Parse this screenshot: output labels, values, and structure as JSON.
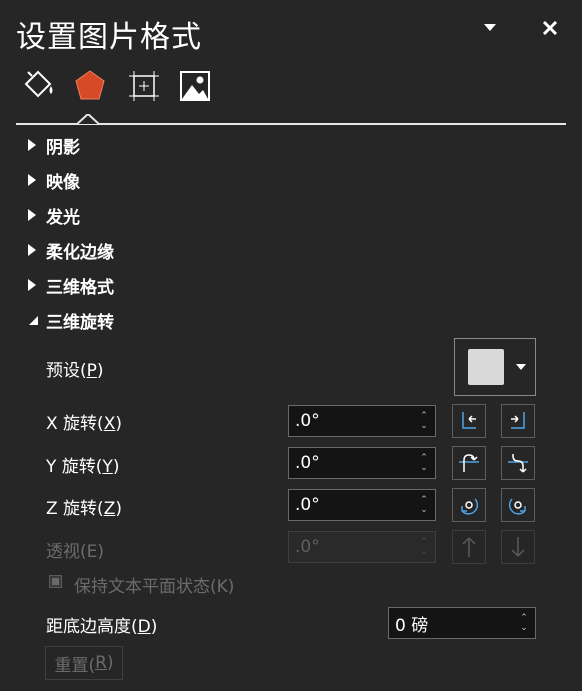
{
  "panel": {
    "title": "设置图片格式"
  },
  "tabs": [
    {
      "icon": "fill-line-icon"
    },
    {
      "icon": "effects-pentagon-icon"
    },
    {
      "icon": "size-properties-icon"
    },
    {
      "icon": "picture-icon"
    }
  ],
  "sections": [
    {
      "label": "阴影",
      "expanded": false
    },
    {
      "label": "映像",
      "expanded": false
    },
    {
      "label": "发光",
      "expanded": false
    },
    {
      "label": "柔化边缘",
      "expanded": false
    },
    {
      "label": "三维格式",
      "expanded": false
    },
    {
      "label": "三维旋转",
      "expanded": true
    }
  ],
  "rotation": {
    "preset": {
      "label_pre": "预设(",
      "key": "P",
      "label_post": ")"
    },
    "x": {
      "label_pre": "X 旋转(",
      "key": "X",
      "label_post": ")",
      "value": ".0°"
    },
    "y": {
      "label_pre": "Y 旋转(",
      "key": "Y",
      "label_post": ")",
      "value": ".0°"
    },
    "z": {
      "label_pre": "Z 旋转(",
      "key": "Z",
      "label_post": ")",
      "value": ".0°"
    },
    "perspective": {
      "label_pre": "透视(",
      "key": "E",
      "label_post": ")",
      "value": ".0°"
    },
    "keep_text_flat": {
      "label_pre": "保持文本平面状态(",
      "key": "K",
      "label_post": ")",
      "checked": false
    },
    "distance": {
      "label_pre": "距底边高度(",
      "key": "D",
      "label_post": ")",
      "value": "0 磅"
    },
    "reset": {
      "label_pre": "重置(",
      "key": "R",
      "label_post": ")"
    }
  },
  "colors": {
    "accent_blue": "#4ea3e6",
    "tab_active": "#d64a28"
  }
}
